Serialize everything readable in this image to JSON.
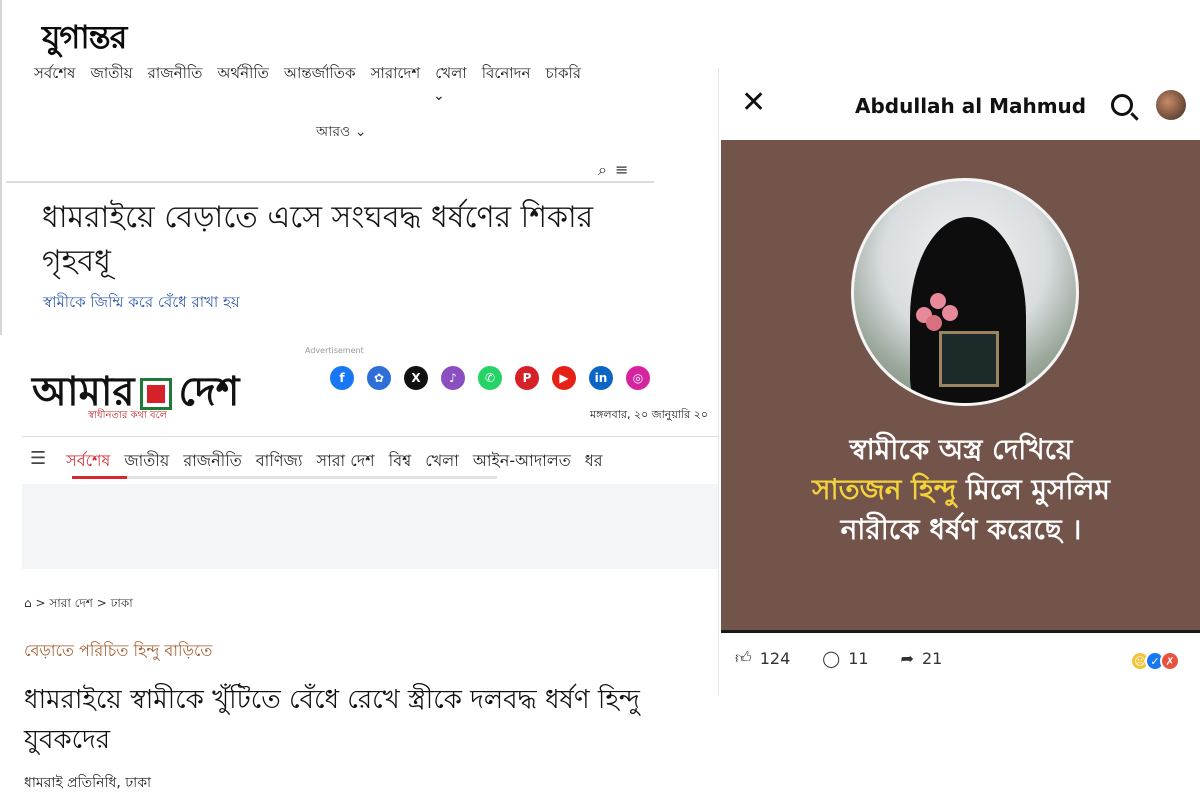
{
  "jugantor": {
    "logo": "যুগান্তর",
    "nav": [
      "সর্বশেষ",
      "জাতীয়",
      "রাজনীতি",
      "অর্থনীতি",
      "আন্তর্জাতিক",
      "সারাদেশ",
      "খেলা",
      "বিনোদন",
      "চাকরি"
    ],
    "more": "আরও ⌄",
    "headline": "ধামরাইয়ে বেড়াতে এসে সংঘবদ্ধ ধর্ষণের শিকার গৃহবধূ",
    "subheadline": "স্বামীকে জিম্মি করে বেঁধে রাখা হয়"
  },
  "amardesh": {
    "advertisement": "Advertisement",
    "logo_left": "আমার",
    "logo_right": "দেশ",
    "tagline": "স্বাধীনতার কথা বলে",
    "date": "মঙ্গলবার, ২০ জানুয়ারি ২০",
    "socials": [
      {
        "icon": "facebook-icon",
        "glyph": "f",
        "color": "#1877f2"
      },
      {
        "icon": "community-icon",
        "glyph": "✿",
        "color": "#2d6fd6"
      },
      {
        "icon": "x-icon",
        "glyph": "X",
        "color": "#111111"
      },
      {
        "icon": "tiktok-icon",
        "glyph": "♪",
        "color": "#8a4fc0"
      },
      {
        "icon": "whatsapp-icon",
        "glyph": "✆",
        "color": "#25d366"
      },
      {
        "icon": "pinterest-icon",
        "glyph": "P",
        "color": "#d6202a"
      },
      {
        "icon": "youtube-icon",
        "glyph": "▶",
        "color": "#e62117"
      },
      {
        "icon": "linkedin-icon",
        "glyph": "in",
        "color": "#0a66c2"
      },
      {
        "icon": "instagram-icon",
        "glyph": "◎",
        "color": "#d6249f"
      }
    ],
    "nav_active": "সর্বশেষ",
    "nav": [
      "জাতীয়",
      "রাজনীতি",
      "বাণিজ্য",
      "সারা দেশ",
      "বিশ্ব",
      "খেলা",
      "আইন-আদালত",
      "ধর"
    ],
    "breadcrumb": "> সারা দেশ > ঢাকা",
    "kicker": "বেড়াতে পরিচিত হিন্দু বাড়িতে",
    "headline": "ধামরাইয়ে স্বামীকে খুঁটিতে বেঁধে রেখে স্ত্রীকে দলবদ্ধ ধর্ষণ হিন্দু যুবকদের",
    "byline": "ধামরাই প্রতিনিধি, ঢাকা"
  },
  "facebook": {
    "profile_name": "Abdullah al Mahmud",
    "caption_line1": "স্বামীকে অস্ত্র দেখিয়ে",
    "caption_highlight": "সাতজন হিন্দু",
    "caption_line2_rest": " মিলে মুসলিম",
    "caption_line3": "নারীকে ধর্ষণ করেছে ।",
    "likes": "124",
    "comments": "11",
    "shares": "21"
  },
  "colors": {
    "facebook_card_bg": "#73544a",
    "caption_highlight": "#f3d23a",
    "amardesh_accent": "#d8272e",
    "jugantor_sub": "#2d5aa8",
    "kicker": "#a45b2e"
  }
}
